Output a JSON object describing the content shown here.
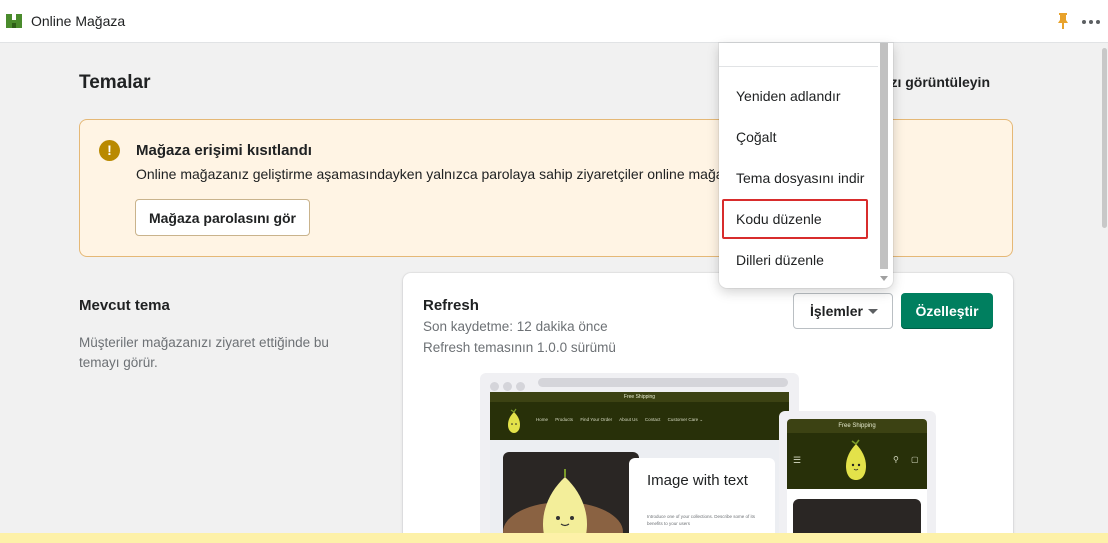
{
  "app": {
    "title": "Online Mağaza"
  },
  "page": {
    "title": "Temalar",
    "view_link": "nızı görüntüleyin"
  },
  "banner": {
    "icon": "!",
    "title": "Mağaza erişimi kısıtlandı",
    "text": "Online mağazanız geliştirme aşamasındayken yalnızca parolaya sahip ziyaretçiler online mağaza",
    "button": "Mağaza parolasını gör"
  },
  "current_theme": {
    "section_title": "Mevcut tema",
    "section_desc": "Müşteriler mağazanızı ziyaret ettiğinde bu temayı görür.",
    "name": "Refresh",
    "saved": "Son kaydetme: 12 dakika önce",
    "version": "Refresh temasının 1.0.0 sürümü",
    "actions_label": "İşlemler",
    "customize_label": "Özelleştir"
  },
  "preview": {
    "announcement": "Free Shipping",
    "mobile_announcement": "Free Shipping",
    "nav_links": [
      "Home",
      "Products",
      "Find Your Order",
      "About Us",
      "Contact",
      "Customer Care ⌄"
    ],
    "hero_heading": "Image with text",
    "hero_body": "Introduce one of your collections. Describe some of its benefits to your users"
  },
  "menu": {
    "items": [
      "Yeniden adlandır",
      "Çoğalt",
      "Tema dosyasını indir",
      "Kodu düzenle",
      "Dilleri düzenle"
    ],
    "highlighted": "Kodu düzenle",
    "highlight_color": "#d82c2c"
  },
  "colors": {
    "primary": "#007f5f",
    "banner_bg": "#fff4e4",
    "warning": "#b98900"
  }
}
